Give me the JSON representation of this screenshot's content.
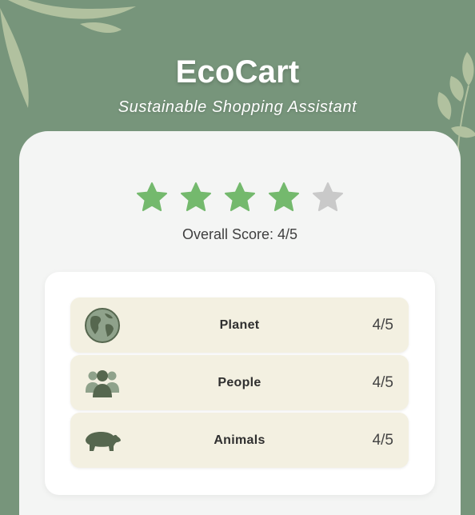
{
  "app": {
    "title": "EcoCart",
    "subtitle": "Sustainable Shopping Assistant"
  },
  "rating": {
    "stars_filled": 4,
    "stars_total": 5,
    "overall_text": "Overall Score: 4/5"
  },
  "categories": [
    {
      "label": "Planet",
      "score": "4/5",
      "icon": "globe-icon"
    },
    {
      "label": "People",
      "score": "4/5",
      "icon": "people-icon"
    },
    {
      "label": "Animals",
      "score": "4/5",
      "icon": "bear-icon"
    }
  ],
  "colors": {
    "background": "#77957b",
    "star_filled": "#74b96d",
    "star_empty": "#c9c9c9",
    "row_background": "#f3f0e1",
    "icon": "#56674f"
  }
}
